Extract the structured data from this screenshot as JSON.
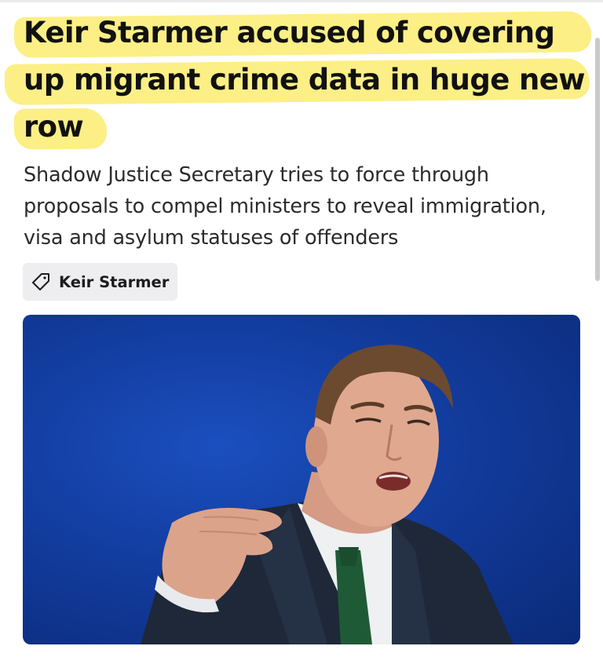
{
  "article": {
    "headline_lines": [
      "Keir Starmer accused of covering",
      "up migrant crime data in huge new",
      "row"
    ],
    "subheadline": "Shadow Justice Secretary tries to force through proposals to compel ministers to reveal immigration, visa and asylum statuses of offenders",
    "tag": {
      "label": "Keir Starmer",
      "icon": "tag-icon"
    }
  },
  "colors": {
    "highlight": "#fcef86",
    "photo_background": "#123c9e",
    "tag_background": "#eeeef0"
  }
}
